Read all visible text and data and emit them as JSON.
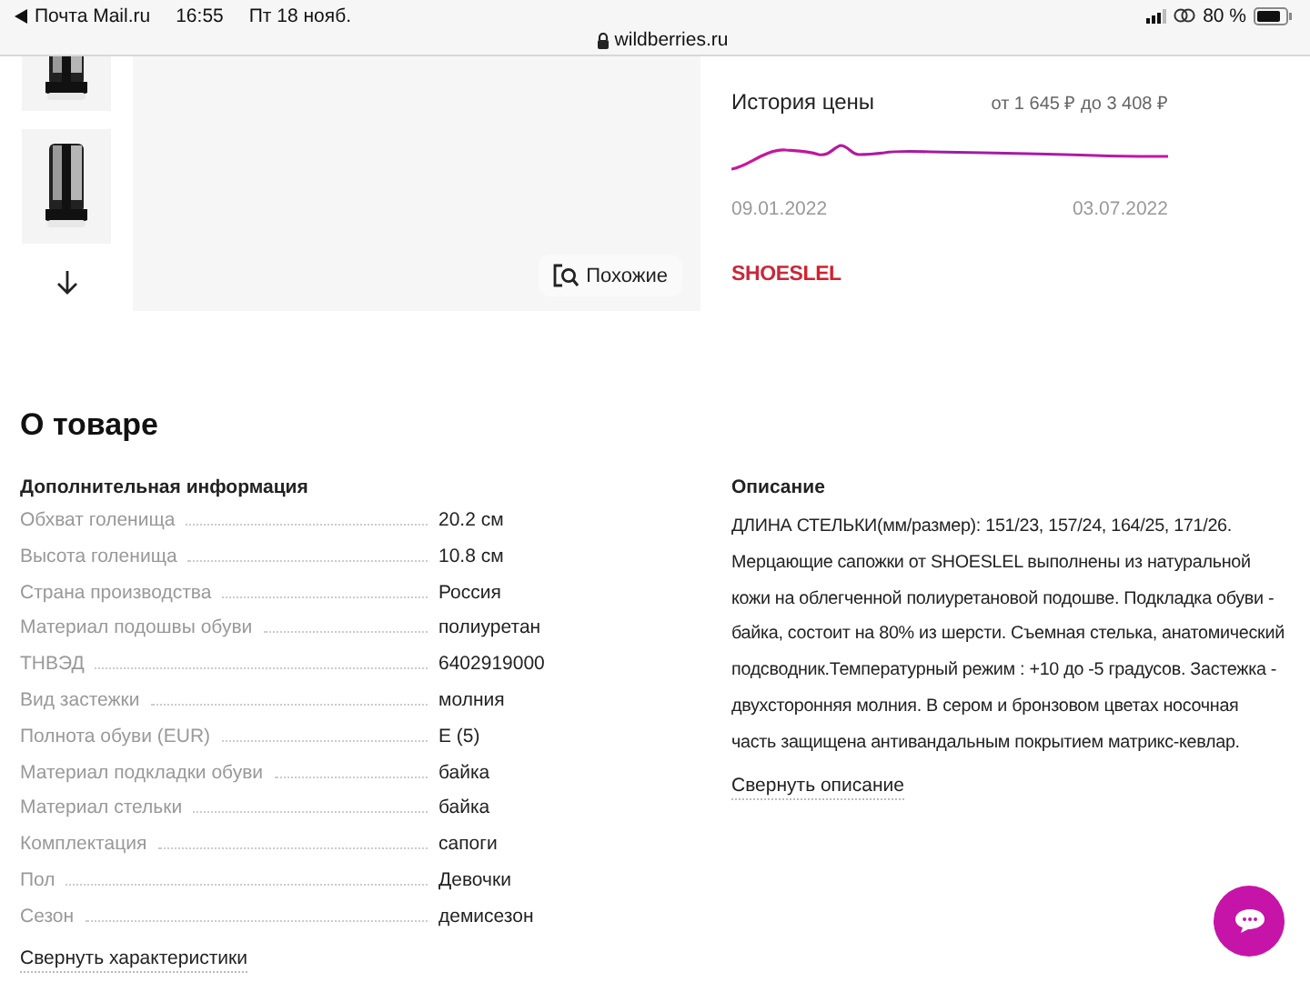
{
  "status_bar": {
    "back_app": "Почта Mail.ru",
    "time": "16:55",
    "date": "Пт 18 нояб.",
    "battery": "80 %"
  },
  "address_bar": {
    "url": "wildberries.ru"
  },
  "gallery": {
    "similar_button": "Похожие"
  },
  "price_history": {
    "title": "История цены",
    "range": "от 1 645 ₽ до 3 408 ₽",
    "start_date": "09.01.2022",
    "end_date": "03.07.2022"
  },
  "brand_logo": "SHOES**LEL**",
  "about": {
    "title": "О товаре",
    "specs_title": "Дополнительная информация",
    "specs": [
      {
        "label": "Обхват голенища",
        "value": "20.2 см"
      },
      {
        "label": "Высота голенища",
        "value": "10.8 см"
      },
      {
        "label": "Страна производства",
        "value": "Россия"
      },
      {
        "label": "Материал подошвы обуви",
        "value": "полиуретан"
      },
      {
        "label": "ТНВЭД",
        "value": "6402919000"
      },
      {
        "label": "Вид застежки",
        "value": "молния"
      },
      {
        "label": "Полнота обуви (EUR)",
        "value": "E (5)"
      },
      {
        "label": "Материал подкладки обуви",
        "value": "байка"
      },
      {
        "label": "Материал стельки",
        "value": "байка"
      },
      {
        "label": "Комплектация",
        "value": "сапоги"
      },
      {
        "label": "Пол",
        "value": "Девочки"
      },
      {
        "label": "Сезон",
        "value": "демисезон"
      }
    ],
    "collapse_specs": "Свернуть характеристики"
  },
  "description": {
    "title": "Описание",
    "text": "ДЛИНА СТЕЛЬКИ(мм/размер): 151/23, 157/24, 164/25, 171/26. Мерцающие сапожки от SHOESLEL выполнены из натуральной кожи на облегченной полиуретановой подошве. Подкладка обуви - байка, состоит на 80% из шерсти. Съемная стелька, анатомический подсводник.Температурный режим : +10 до -5 градусов. Застежка - двухсторонняя молния. В сером и бронзовом цветах носочная часть защищена антивандальным покрытием матрикс-кевлар.",
    "collapse": "Свернуть описание"
  }
}
